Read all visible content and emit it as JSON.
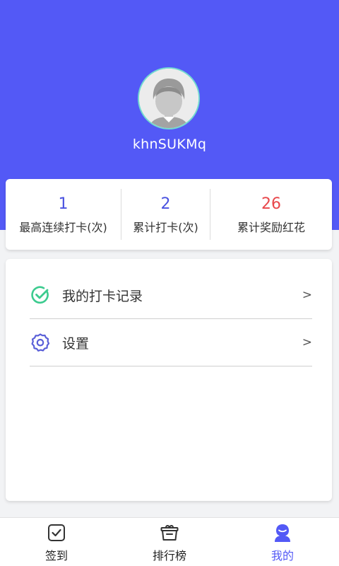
{
  "profile": {
    "username": "khnSUKMq",
    "avatar_icon": "default-avatar-icon"
  },
  "stats": [
    {
      "value": "1",
      "label": "最高连续打卡(次)",
      "color": "#4a52e0"
    },
    {
      "value": "2",
      "label": "累计打卡(次)",
      "color": "#4a52e0"
    },
    {
      "value": "26",
      "label": "累计奖励红花",
      "color": "#e8474b"
    }
  ],
  "menu": {
    "items": [
      {
        "label": "我的打卡记录",
        "arrow": ">",
        "icon": "check-circle-icon",
        "icon_color": "#3ccb8f"
      },
      {
        "label": "设置",
        "arrow": ">",
        "icon": "gear-icon",
        "icon_color": "#5a5fd8"
      }
    ]
  },
  "tabbar": {
    "tabs": [
      {
        "label": "签到",
        "icon": "checkin-icon",
        "active": false
      },
      {
        "label": "排行榜",
        "icon": "ranking-box-icon",
        "active": false
      },
      {
        "label": "我的",
        "icon": "profile-icon",
        "active": true
      }
    ]
  },
  "colors": {
    "brand": "#5359f6",
    "background": "#f2f3f5",
    "highlight_red": "#e8474b"
  }
}
